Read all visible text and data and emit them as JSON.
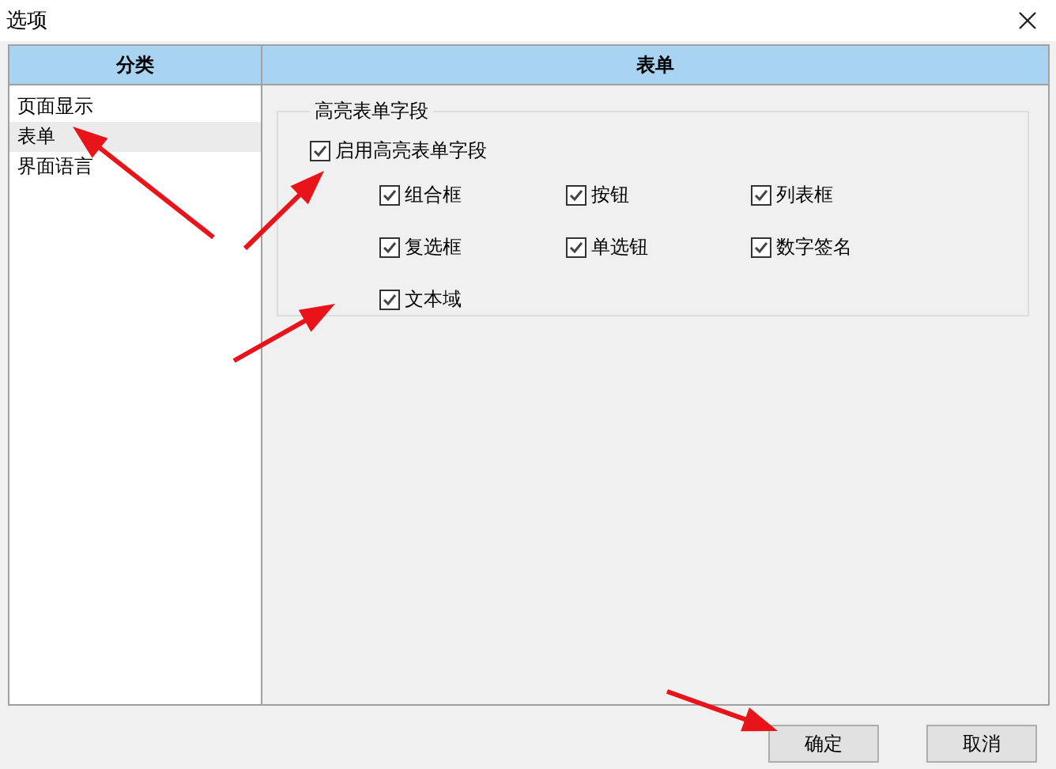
{
  "window": {
    "title": "选项"
  },
  "table": {
    "columns": [
      "分类",
      "表单"
    ]
  },
  "sidebar": {
    "items": [
      {
        "label": "页面显示",
        "selected": false
      },
      {
        "label": "表单",
        "selected": true
      },
      {
        "label": "界面语言",
        "selected": false
      }
    ]
  },
  "group": {
    "title": "高亮表单字段",
    "master": {
      "label": "启用高亮表单字段",
      "checked": true
    },
    "options": [
      {
        "label": "组合框",
        "checked": true
      },
      {
        "label": "按钮",
        "checked": true
      },
      {
        "label": "列表框",
        "checked": true
      },
      {
        "label": "复选框",
        "checked": true
      },
      {
        "label": "单选钮",
        "checked": true
      },
      {
        "label": "数字签名",
        "checked": true
      },
      {
        "label": "文本域",
        "checked": true
      }
    ]
  },
  "buttons": [
    {
      "label": "确定"
    },
    {
      "label": "取消"
    }
  ]
}
